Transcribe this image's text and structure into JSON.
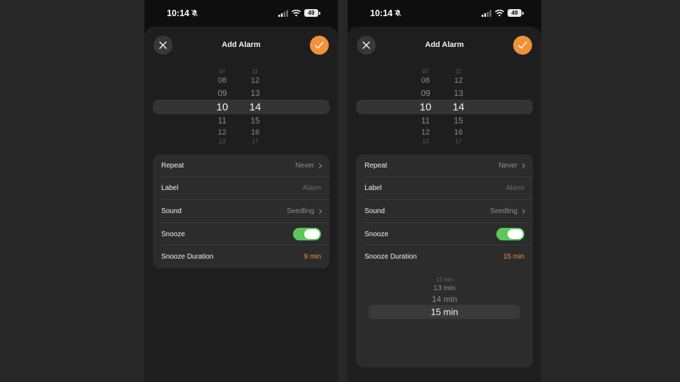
{
  "accent_color": "#f0923a",
  "toggle_color": "#5ac85a",
  "status_bar": {
    "time": "10:14",
    "battery": "49",
    "icons": [
      "bell-slash-icon",
      "signal-icon",
      "wifi-icon",
      "battery-icon"
    ]
  },
  "left": {
    "title": "Add Alarm",
    "hour_wheel": [
      "07",
      "08",
      "09",
      "10",
      "11",
      "12",
      "13"
    ],
    "minute_wheel": [
      "11",
      "12",
      "13",
      "14",
      "15",
      "16",
      "17"
    ],
    "rows": {
      "repeat_label": "Repeat",
      "repeat_value": "Never",
      "label_label": "Label",
      "label_placeholder": "Alarm",
      "sound_label": "Sound",
      "sound_value": "Seedling",
      "snooze_label": "Snooze",
      "snooze_on": true,
      "duration_label": "Snooze Duration",
      "duration_value": "9 min"
    }
  },
  "right": {
    "title": "Add Alarm",
    "hour_wheel": [
      "07",
      "08",
      "09",
      "10",
      "11",
      "12",
      "13"
    ],
    "minute_wheel": [
      "11",
      "12",
      "13",
      "14",
      "15",
      "16",
      "17"
    ],
    "rows": {
      "repeat_label": "Repeat",
      "repeat_value": "Never",
      "label_label": "Label",
      "label_placeholder": "Alarm",
      "sound_label": "Sound",
      "sound_value": "Seedling",
      "snooze_label": "Snooze",
      "snooze_on": true,
      "duration_label": "Snooze Duration",
      "duration_value": "15 min"
    },
    "duration_wheel": [
      "12 min",
      "13 min",
      "14 min",
      "15 min"
    ]
  }
}
